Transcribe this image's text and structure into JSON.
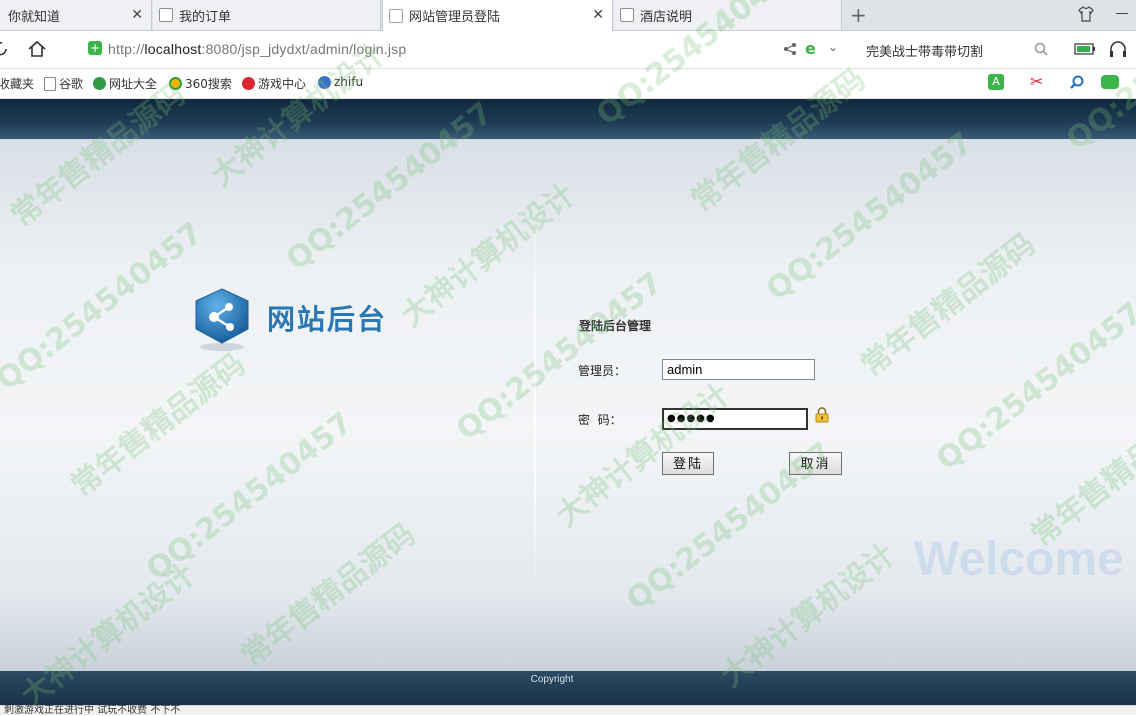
{
  "tabs": [
    {
      "label": "你就知道",
      "active": false
    },
    {
      "label": "我的订单",
      "active": false
    },
    {
      "label": "网站管理员登陆",
      "active": true
    },
    {
      "label": "酒店说明",
      "active": false
    }
  ],
  "address_bar": {
    "url_prefix": "http://",
    "url_host": "localhost",
    "url_rest": ":8080/jsp_jdydxt/admin/login.jsp",
    "search_suggestion": "完美战士带毒带切割"
  },
  "bookmarks": [
    {
      "label": "收藏夹",
      "color": ""
    },
    {
      "label": "谷歌",
      "color": "#ffffff"
    },
    {
      "label": "网址大全",
      "color": "#2f9a3f"
    },
    {
      "label": "360搜索",
      "color": "#f5b400"
    },
    {
      "label": "游戏中心",
      "color": "#d8262c"
    },
    {
      "label": "zhifu",
      "color": "#3b73c6"
    }
  ],
  "page": {
    "logo_text": "网站后台",
    "form_title": "登陆后台管理",
    "username_label": "管理员：",
    "username_value": "admin",
    "password_label": "密  码：",
    "password_value": "●●●●●",
    "login_button": "登陆",
    "cancel_button": "取消",
    "welcome_text": "Welcome",
    "copyright": "Copyright"
  },
  "watermarks": [
    "QQ:254540457",
    "常年售精品源码",
    "大神计算机设计"
  ],
  "status_text": "刺激游戏正在进行中 试玩不收费 不下不"
}
